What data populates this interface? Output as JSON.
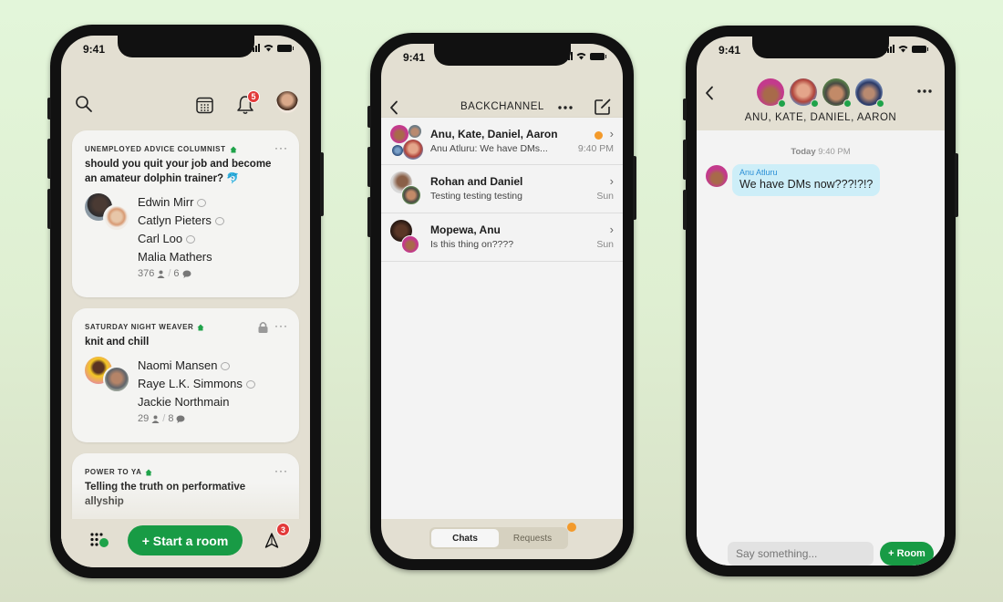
{
  "status_bar": {
    "time": "9:41"
  },
  "hallway": {
    "notification_count": "5",
    "rooms": [
      {
        "club": "UNEMPLOYED ADVICE COLUMNIST",
        "title": "should you quit your job and become an amateur dolphin trainer? 🐬",
        "speakers": [
          "Edwin Mirr",
          "Catlyn Pieters",
          "Carl Loo",
          "Malia Mathers"
        ],
        "speaker_chatting": [
          true,
          true,
          true,
          false
        ],
        "listeners": "376",
        "speaker_count": "6",
        "locked": false
      },
      {
        "club": "SATURDAY NIGHT WEAVER",
        "title": "knit and chill",
        "speakers": [
          "Naomi Mansen",
          "Raye L.K. Simmons",
          "Jackie Northmain"
        ],
        "speaker_chatting": [
          true,
          true,
          false
        ],
        "listeners": "29",
        "speaker_count": "8",
        "locked": true
      },
      {
        "club": "POWER TO YA",
        "title": "Telling the truth on performative allyship",
        "locked": false
      }
    ],
    "start_room_label": "+ Start a room",
    "messages_badge": "3"
  },
  "backchannel": {
    "title": "BACKCHANNEL",
    "threads": [
      {
        "name": "Anu, Kate, Daniel, Aaron",
        "preview": "Anu Atluru: We have DMs...",
        "time": "9:40 PM",
        "unread": true
      },
      {
        "name": "Rohan and Daniel",
        "preview": "Testing testing testing",
        "time": "Sun",
        "unread": false
      },
      {
        "name": "Mopewa, Anu",
        "preview": "Is this thing on????",
        "time": "Sun",
        "unread": false
      }
    ],
    "tabs": {
      "chats": "Chats",
      "requests": "Requests"
    },
    "requests_has_new": true
  },
  "conversation": {
    "participants_label": "ANU, KATE, DANIEL, AARON",
    "date_label_bold": "Today",
    "date_label_time": "9:40 PM",
    "messages": [
      {
        "sender": "Anu Atluru",
        "text": "We have DMs now???!?!?"
      }
    ],
    "composer_placeholder": "Say something...",
    "room_button": "+ Room"
  },
  "colors": {
    "accent_green": "#189b45",
    "badge_red": "#e23a3a",
    "unread_orange": "#f39a2b",
    "bubble_blue": "#cdeef8",
    "sender_blue": "#2b8fd6",
    "app_bg": "#e3dfd2"
  }
}
